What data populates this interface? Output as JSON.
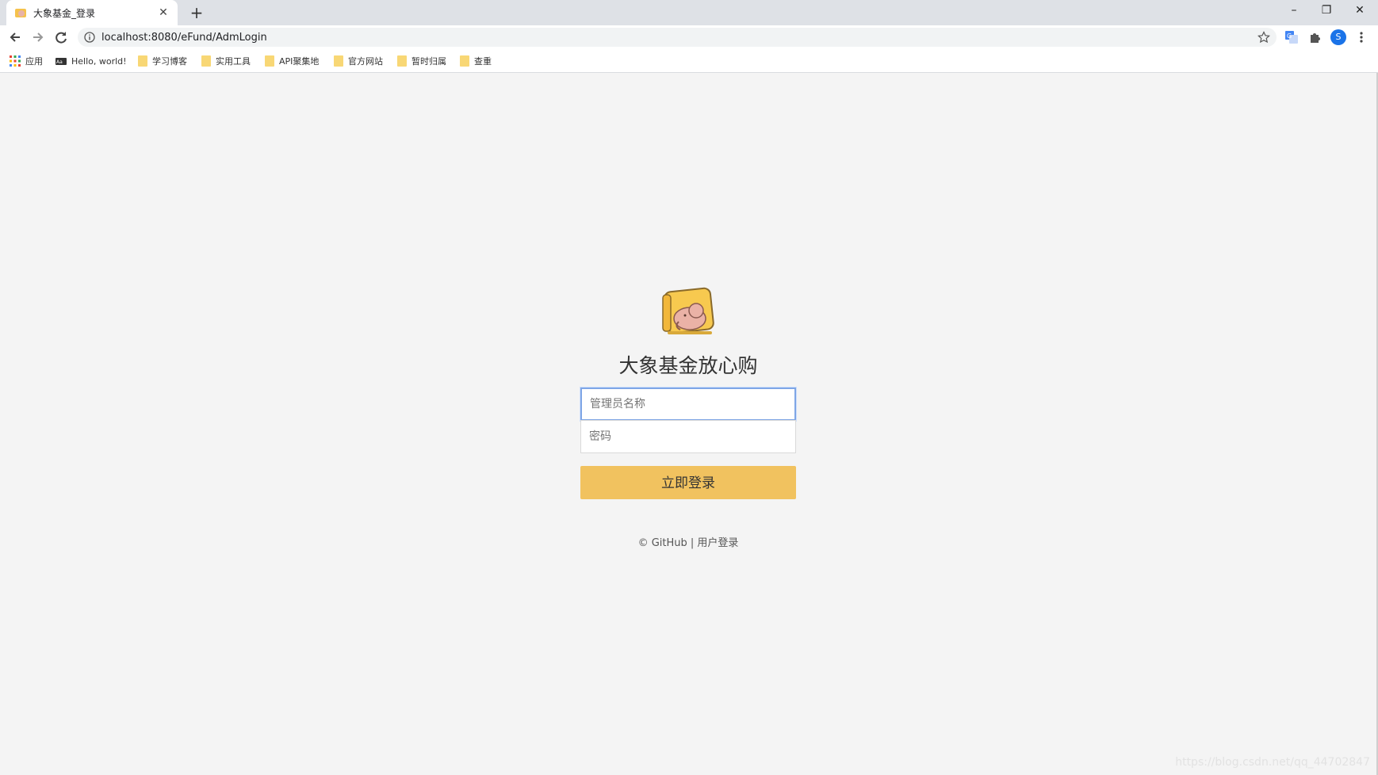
{
  "browser": {
    "tab_title": "大象基金_登录",
    "url": "localhost:8080/eFund/AdmLogin",
    "profile_initial": "S",
    "bookmarks": [
      {
        "label": "应用",
        "icon": "apps-grid-icon"
      },
      {
        "label": "Hello, world!",
        "icon": "site-favicon-icon"
      },
      {
        "label": "学习博客",
        "icon": "folder-icon"
      },
      {
        "label": "实用工具",
        "icon": "folder-icon"
      },
      {
        "label": "API聚集地",
        "icon": "folder-icon"
      },
      {
        "label": "官方网站",
        "icon": "folder-icon"
      },
      {
        "label": "暂时归属",
        "icon": "folder-icon"
      },
      {
        "label": "查重",
        "icon": "folder-icon"
      }
    ]
  },
  "login": {
    "brand_title": "大象基金放心购",
    "username_placeholder": "管理员名称",
    "username_value": "",
    "password_placeholder": "密码",
    "password_value": "",
    "submit_label": "立即登录",
    "footer_copyright": "© GitHub",
    "footer_separator": "|",
    "footer_link": "用户登录"
  },
  "watermark": "https://blog.csdn.net/qq_44702847",
  "colors": {
    "button": "#f1c25f",
    "page_bg": "#f4f4f4",
    "focus_border": "#7fa6e6"
  }
}
